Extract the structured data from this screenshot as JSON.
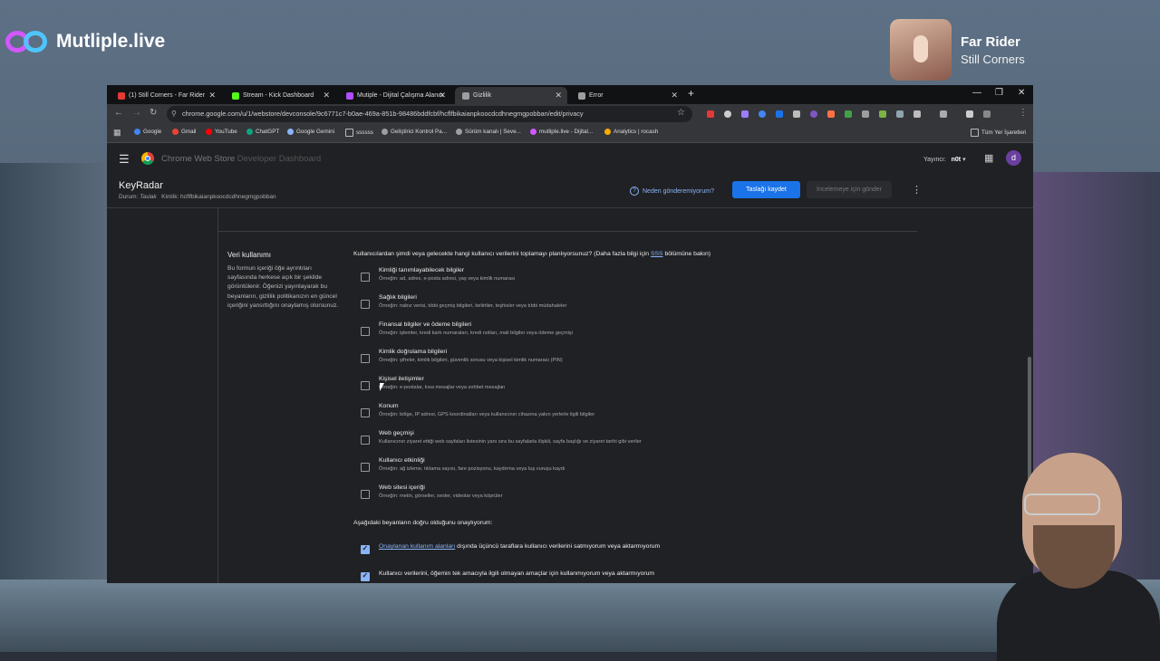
{
  "overlay": {
    "logo_text": "Mutliple.live",
    "now_playing_title": "Far Rider",
    "now_playing_artist": "Still Corners"
  },
  "browser": {
    "tabs": [
      {
        "label": "(1) Still Corners - Far Rider",
        "color": "#e53935"
      },
      {
        "label": "Stream - Kick Dashboard",
        "color": "#53fc18"
      },
      {
        "label": "Mutiple - Dijital Çalışma Alanın",
        "color": "#b04fff"
      },
      {
        "label": "Gizlilik",
        "color": "#9e9e9e"
      },
      {
        "label": "Error",
        "color": "#9e9e9e"
      }
    ],
    "url": "chrome.google.com/u/1/webstore/devconsole/9c6771c7-b0ae-469a-851b-98486bddfcbf/hcflfbikaianpkoocdcdhnegmgpobban/edit/privacy",
    "bookmarks": [
      {
        "label": "Google",
        "color": "#4285f4"
      },
      {
        "label": "Gmail",
        "color": "#ea4335"
      },
      {
        "label": "YouTube",
        "color": "#ff0000"
      },
      {
        "label": "ChatGPT",
        "color": "#10a37f"
      },
      {
        "label": "Google Gemini",
        "color": "#8ab4f8"
      },
      {
        "label": "ssssss",
        "color": "#9e9e9e"
      },
      {
        "label": "Geliştirici Kontrol Pa...",
        "color": "#9e9e9e"
      },
      {
        "label": "Sürüm kanalı | Seve...",
        "color": "#9e9e9e"
      },
      {
        "label": "mutliple.live - Dijital...",
        "color": "#d257ff"
      },
      {
        "label": "Analytics | rocash",
        "color": "#f9ab00"
      }
    ],
    "all_bookmarks": "Tüm Yer İşaretleri"
  },
  "app": {
    "title_brand": "Chrome Web Store",
    "title_section": "Developer Dashboard",
    "publisher_label": "Yayıncı:",
    "publisher_name": "n0t",
    "avatar_letter": "d",
    "item_name": "KeyRadar",
    "status_label": "Durum:",
    "status_value": "Taslak",
    "id_text": "Kimlik: hcflfbikaianpkoocdcdhnegmgpobban",
    "why_link": "Neden gönderemiyorum?",
    "save_button": "Taslağı kaydet",
    "review_button": "İncelemeye için gönder"
  },
  "privacy": {
    "section_title": "Veri kullanımı",
    "section_desc": "Bu formun içeriği öğe ayrıntıları sayfasında herkese açık bir şekilde görüntülenir. Öğenizi yayınlayarak bu beyanların, gizlilik politikanızın en güncel içeriğini yansıttığını onaylamış olursunuz.",
    "question_pre": "Kullanıcılardan şimdi veya gelecekte hangi kullanıcı verilerini toplamayı planlıyorsunuz? (Daha fazla bilgi için",
    "question_link": "SSS",
    "question_post": "bölümüne bakın)",
    "items": [
      {
        "label": "Kimliği tanımlayabilecek bilgiler",
        "hint": "Örneğin: ad, adres, e-posta adresi, yaş veya kimlik numarası"
      },
      {
        "label": "Sağlık bilgileri",
        "hint": "Örneğin: nabız verisi, tıbbi geçmiş bilgileri, belirtiler, teşhisler veya tıbbi müdahaleler"
      },
      {
        "label": "Finansal bilgiler ve ödeme bilgileri",
        "hint": "Örneğin: işlemler, kredi kartı numaraları, kredi notları, mali bilgiler veya ödeme geçmişi"
      },
      {
        "label": "Kimlik doğrulama bilgileri",
        "hint": "Örneğin: şifreler, kimlik bilgileri, güvenlik sorusu veya kişisel kimlik numarası (PIN)"
      },
      {
        "label": "Kişisel iletişimler",
        "hint": "Örneğin: e-postalar, kısa mesajlar veya sohbet mesajları"
      },
      {
        "label": "Konum",
        "hint": "Örneğin: bölge, IP adresi, GPS koordinatları veya kullanıcının cihazına yakın yerlerle ilgili bilgiler"
      },
      {
        "label": "Web geçmişi",
        "hint": "Kullanıcının ziyaret ettiği web sayfaları listesinin yanı sıra bu sayfalarla ilişkili, sayfa başlığı ve ziyaret tarihi gibi veriler"
      },
      {
        "label": "Kullanıcı etkinliği",
        "hint": "Örneğin: ağ izleme, tıklama sayısı, fare pozisyonu, kaydırma veya tuş vuruşu kaydı"
      },
      {
        "label": "Web sitesi içeriği",
        "hint": "Örneğin: metin, görseller, sesler, videolar veya köprüler"
      }
    ],
    "cert_title": "Aşağıdaki beyanların doğru olduğunu onaylıyorum:",
    "cert1_link": "Onaylanan kullanım alanları",
    "cert1_rest": "dışında üçüncü taraflara kullanıcı verilerini satmıyorum veya aktarmıyorum",
    "cert2": "Kullanıcı verilerini, öğemin tek amacıyla ilgili olmayan amaçlar için kullanmıyorum veya aktarmıyorum"
  }
}
